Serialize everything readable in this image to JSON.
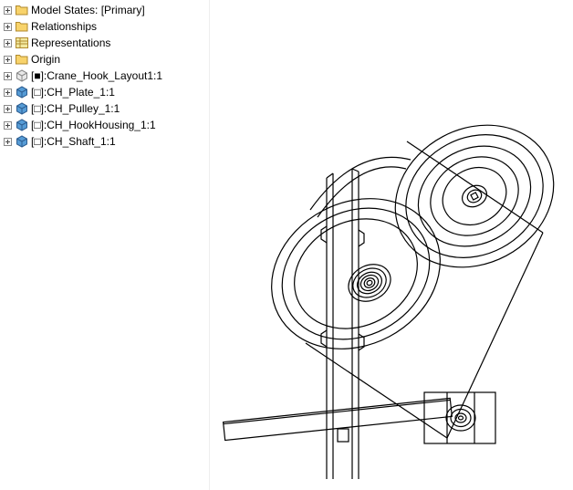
{
  "tree": {
    "items": [
      {
        "icon": "folder",
        "expandable": true,
        "label": "Model States: [Primary]"
      },
      {
        "icon": "folder",
        "expandable": true,
        "label": "Relationships"
      },
      {
        "icon": "reps",
        "expandable": true,
        "label": "Representations"
      },
      {
        "icon": "folder",
        "expandable": true,
        "label": "Origin"
      },
      {
        "icon": "layout",
        "expandable": true,
        "label": "[■]:Crane_Hook_Layout1:1"
      },
      {
        "icon": "part",
        "expandable": true,
        "label": "[□]:CH_Plate_1:1"
      },
      {
        "icon": "part",
        "expandable": true,
        "label": "[□]:CH_Pulley_1:1"
      },
      {
        "icon": "part",
        "expandable": true,
        "label": "[□]:CH_HookHousing_1:1"
      },
      {
        "icon": "part",
        "expandable": true,
        "label": "[□]:CH_Shaft_1:1"
      }
    ]
  },
  "icons": {
    "folder_fill": "#F8D36B",
    "folder_stroke": "#B08A2E",
    "part_fill": "#569CD6",
    "part_stroke": "#2E5E91",
    "reps_fill": "#F2E9A0",
    "reps_stroke": "#B08A2E",
    "layout_fill": "#E8E8E8",
    "layout_stroke": "#888888"
  },
  "canvas": {
    "stroke": "#000000"
  }
}
